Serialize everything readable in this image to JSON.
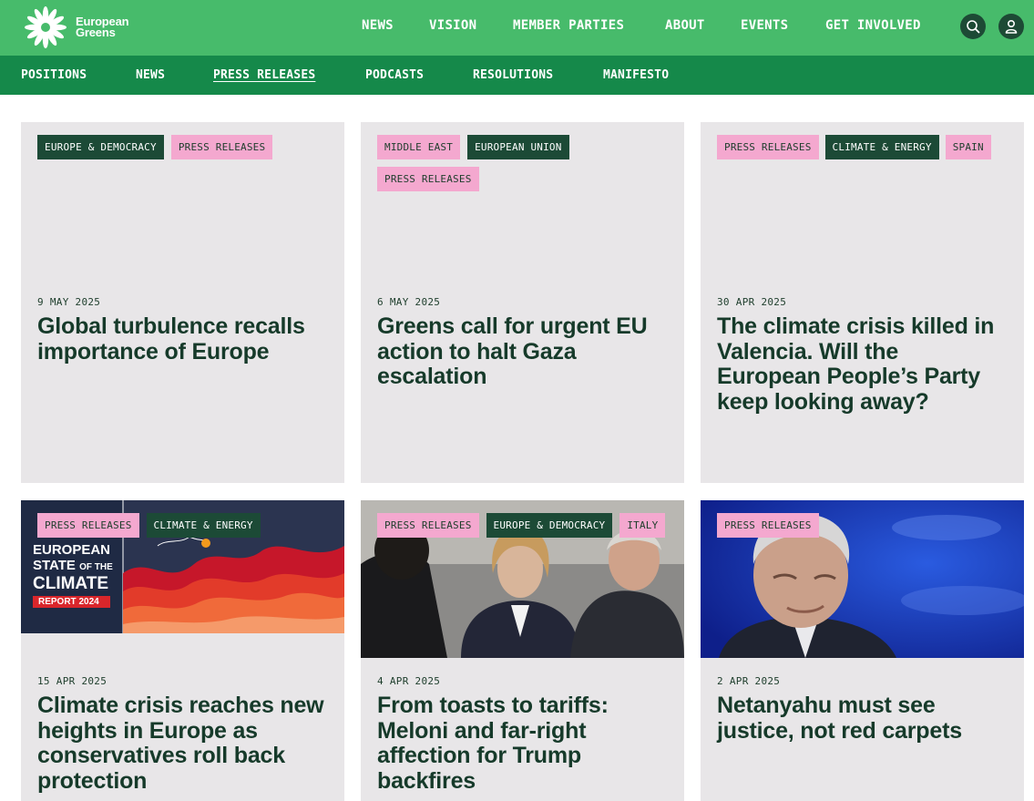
{
  "logo": {
    "line1": "European",
    "line2": "Greens"
  },
  "main_nav": [
    "NEWS",
    "VISION",
    "MEMBER PARTIES",
    "ABOUT",
    "EVENTS",
    "GET INVOLVED"
  ],
  "sub_nav": [
    "POSITIONS",
    "NEWS",
    "PRESS RELEASES",
    "PODCASTS",
    "RESOLUTIONS",
    "MANIFESTO"
  ],
  "sub_nav_active": "PRESS RELEASES",
  "colors": {
    "topbar": "#47bb6b",
    "subbar": "#15894a",
    "card": "#e8e6e8",
    "tag_pink": "#f4a8cf",
    "tag_dark": "#1c4a36"
  },
  "cards": [
    {
      "tags": [
        {
          "label": "EUROPE & DEMOCRACY",
          "style": "dark"
        },
        {
          "label": "PRESS RELEASES",
          "style": "pink"
        }
      ],
      "date": "9 MAY 2025",
      "title": "Global turbulence recalls importance of Europe"
    },
    {
      "tags": [
        {
          "label": "MIDDLE EAST",
          "style": "pink"
        },
        {
          "label": "EUROPEAN UNION",
          "style": "dark"
        },
        {
          "label": "PRESS RELEASES",
          "style": "pink"
        }
      ],
      "date": "6 MAY 2025",
      "title": "Greens call for urgent EU action to halt Gaza escalation"
    },
    {
      "tags": [
        {
          "label": "PRESS RELEASES",
          "style": "pink"
        },
        {
          "label": "CLIMATE & ENERGY",
          "style": "dark"
        },
        {
          "label": "SPAIN",
          "style": "pink"
        }
      ],
      "date": "30 APR 2025",
      "title": "The climate crisis killed in Valencia. Will the European People’s Party keep looking away?"
    },
    {
      "tags": [
        {
          "label": "PRESS RELEASES",
          "style": "pink"
        },
        {
          "label": "CLIMATE & ENERGY",
          "style": "dark"
        }
      ],
      "date": "15 APR 2025",
      "title": "Climate crisis reaches new heights in Europe as conservatives roll back protection",
      "image": {
        "line1": "EUROPEAN",
        "line2": "STATE",
        "line2b": "OF THE",
        "line3": "CLIMATE",
        "badge": "REPORT 2024"
      }
    },
    {
      "tags": [
        {
          "label": "PRESS RELEASES",
          "style": "pink"
        },
        {
          "label": "EUROPE & DEMOCRACY",
          "style": "dark"
        },
        {
          "label": "ITALY",
          "style": "pink"
        }
      ],
      "date": "4 APR 2025",
      "title": "From toasts to tariffs: Meloni and far-right affection for Trump backfires"
    },
    {
      "tags": [
        {
          "label": "PRESS RELEASES",
          "style": "pink"
        }
      ],
      "date": "2 APR 2025",
      "title": "Netanyahu must see justice, not red carpets"
    }
  ]
}
